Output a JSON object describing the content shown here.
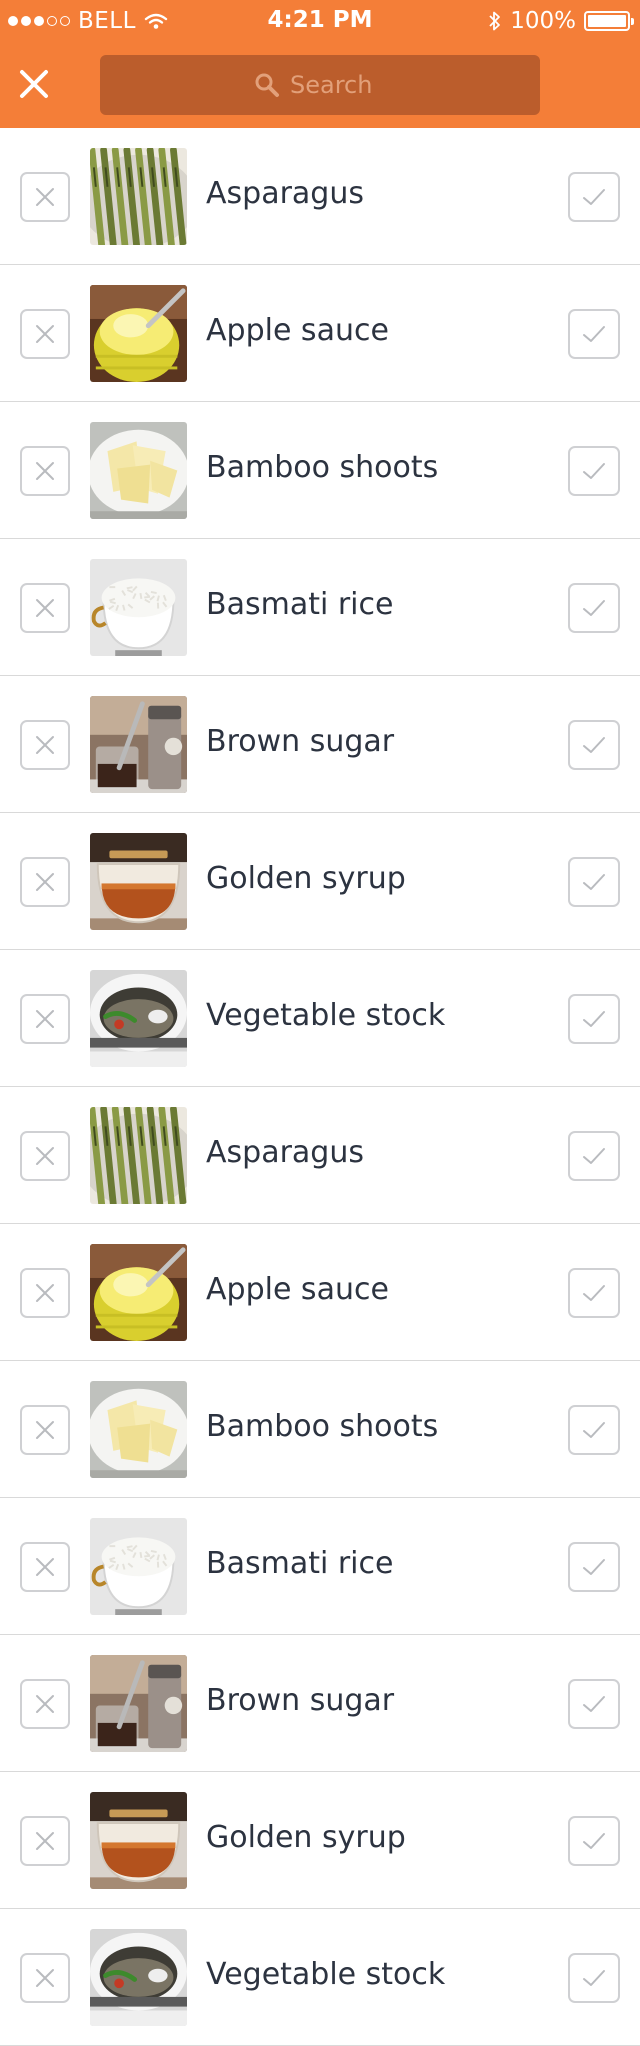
{
  "status_bar": {
    "carrier": "BELL",
    "time": "4:21 PM",
    "battery": "100%",
    "signal_bars_filled": 3,
    "signal_bars_total": 5
  },
  "header": {
    "close_icon": "close-icon",
    "search_placeholder": "Search",
    "search_value": "",
    "search_icon": "search-icon"
  },
  "colors": {
    "header": "#f47e38",
    "search_field": "#bb5d2c",
    "text": "#2c3340",
    "control_border": "#cfd0d3",
    "divider": "#d9d9d9"
  },
  "ingredients": [
    {
      "name": "Asparagus",
      "thumb": "asparagus"
    },
    {
      "name": "Apple sauce",
      "thumb": "apple-sauce"
    },
    {
      "name": "Bamboo shoots",
      "thumb": "bamboo-shoots"
    },
    {
      "name": "Basmati rice",
      "thumb": "basmati-rice"
    },
    {
      "name": "Brown sugar",
      "thumb": "brown-sugar"
    },
    {
      "name": "Golden syrup",
      "thumb": "golden-syrup"
    },
    {
      "name": "Vegetable stock",
      "thumb": "vegetable-stock"
    },
    {
      "name": "Asparagus",
      "thumb": "asparagus"
    },
    {
      "name": "Apple sauce",
      "thumb": "apple-sauce"
    },
    {
      "name": "Bamboo shoots",
      "thumb": "bamboo-shoots"
    },
    {
      "name": "Basmati rice",
      "thumb": "basmati-rice"
    },
    {
      "name": "Brown sugar",
      "thumb": "brown-sugar"
    },
    {
      "name": "Golden syrup",
      "thumb": "golden-syrup"
    },
    {
      "name": "Vegetable stock",
      "thumb": "vegetable-stock"
    }
  ]
}
